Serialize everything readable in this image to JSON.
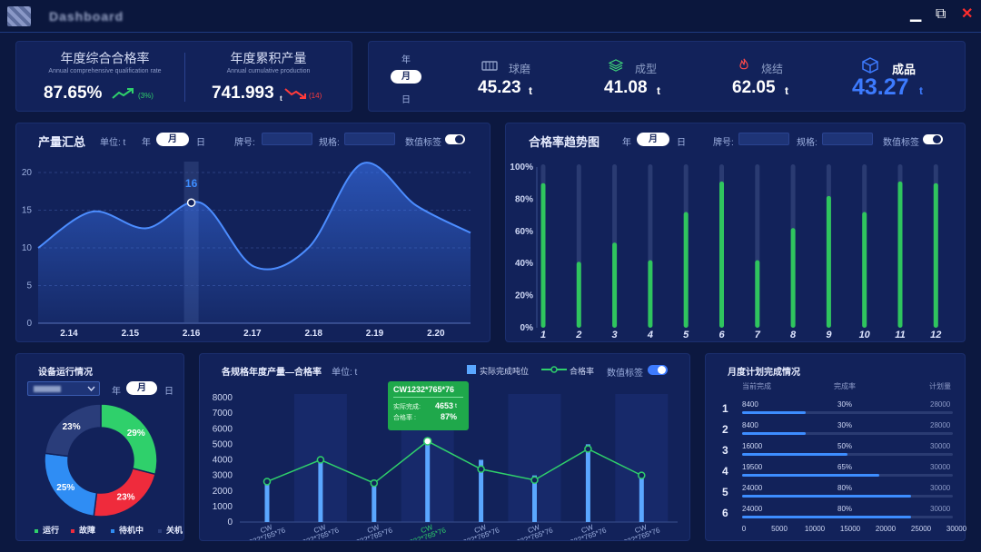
{
  "window": {
    "title": "Dashboard",
    "minimize": "▁",
    "restore": "⧉",
    "close": "✕"
  },
  "kpi_left": [
    {
      "title": "年度综合合格率",
      "subtitle": "Annual comprehensive qualification rate",
      "value": "87.65%",
      "trend": "up",
      "trend_text": "(3%)",
      "trend_color": "#2fd06b"
    },
    {
      "title": "年度累积产量",
      "subtitle": "Annual cumulative production",
      "value": "741.993",
      "unit": "t",
      "trend": "down",
      "trend_text": "(14)",
      "trend_color": "#ff3b3b"
    }
  ],
  "period_selector": {
    "options": [
      "年",
      "月",
      "日"
    ],
    "selected": "月"
  },
  "products": [
    {
      "name": "球磨",
      "value": "45.23",
      "unit": "t",
      "icon": "ball-mill-icon",
      "color": "#8fa0c8"
    },
    {
      "name": "成型",
      "value": "41.08",
      "unit": "t",
      "icon": "layers-icon",
      "color": "#3ed47a"
    },
    {
      "name": "烧结",
      "value": "62.05",
      "unit": "t",
      "icon": "flame-icon",
      "color": "#ff4a4a"
    },
    {
      "name": "成品",
      "value": "43.27",
      "unit": "t",
      "icon": "cube-icon",
      "color": "#3d7bff",
      "highlight": true
    }
  ],
  "production": {
    "title": "产量汇总",
    "unit_label": "单位: t",
    "periods": [
      "年",
      "月",
      "日"
    ],
    "selected": "月",
    "brand_label": "牌号:",
    "spec_label": "规格:",
    "toggle_label": "数值标签",
    "chart_data": {
      "type": "area",
      "x": [
        "2.14",
        "2.15",
        "2.16",
        "2.17",
        "2.18",
        "2.19",
        "2.20"
      ],
      "values": [
        10,
        14.8,
        12.6,
        16,
        7.5,
        10,
        21.2,
        15.6,
        12
      ],
      "highlight": {
        "x": "2.16",
        "value": 16,
        "label": "16"
      },
      "yticks": [
        0,
        5,
        10,
        15,
        20
      ],
      "ylim": [
        0,
        20
      ]
    }
  },
  "passrate": {
    "title": "合格率趋势图",
    "periods": [
      "年",
      "月",
      "日"
    ],
    "selected": "月",
    "brand_label": "牌号:",
    "spec_label": "规格:",
    "toggle_label": "数值标签",
    "chart_data": {
      "type": "bar",
      "categories": [
        "1",
        "2",
        "3",
        "4",
        "5",
        "6",
        "7",
        "8",
        "9",
        "10",
        "11",
        "12"
      ],
      "values": [
        90,
        41,
        53,
        42,
        72,
        91,
        42,
        62,
        82,
        72,
        91,
        90
      ],
      "yticks": [
        "0%",
        "20%",
        "40%",
        "60%",
        "80%",
        "100%"
      ],
      "ylim": [
        0,
        100
      ]
    }
  },
  "equipment": {
    "title": "设备运行情况",
    "periods": [
      "年",
      "月",
      "日"
    ],
    "selected": "月",
    "chart_data": {
      "type": "pie",
      "slices": [
        {
          "name": "运行",
          "value": 29,
          "label": "29%",
          "color": "#2fd06b"
        },
        {
          "name": "故障",
          "value": 23,
          "label": "23%",
          "color": "#ef2b3c"
        },
        {
          "name": "待机中",
          "value": 25,
          "label": "25%",
          "color": "#2f8df4"
        },
        {
          "name": "关机",
          "value": 23,
          "label": "23%",
          "color": "#2a3d7a"
        }
      ]
    }
  },
  "spec_chart": {
    "title": "各规格年度产量—合格率",
    "unit_label": "单位: t",
    "legend_bar": "实际完成吨位",
    "legend_line": "合格率",
    "toggle_label": "数值标签",
    "tooltip": {
      "title": "CW1232*765*76",
      "row1_label": "实际完成:",
      "row1_value": "4653",
      "row1_unit": "t",
      "row2_label": "合格率    :",
      "row2_value": "87%"
    },
    "chart_data": {
      "type": "bar",
      "categories": [
        "CW 1232*765*76",
        "CW 1232*765*76",
        "CW 1232*765*76",
        "CW 1232*765*76",
        "CW 1232*765*76",
        "CW 1232*765*76",
        "CW 1232*765*76",
        "CW 1232*765*76"
      ],
      "bars": [
        2700,
        3800,
        2700,
        5100,
        4000,
        3000,
        5000,
        3000
      ],
      "line": [
        2600,
        4000,
        2500,
        5200,
        3400,
        2700,
        4700,
        3000
      ],
      "yticks": [
        0,
        1000,
        2000,
        3000,
        4000,
        5000,
        6000,
        7000,
        8000
      ],
      "ylim": [
        0,
        8000
      ],
      "highlight_index": 3
    }
  },
  "monthly": {
    "title": "月度计划完成情况",
    "col1": "当前完成",
    "col2": "完成率",
    "col3": "计划量",
    "rows": [
      {
        "rank": "1",
        "current": "8400",
        "rate": "30%",
        "plan": "28000",
        "pct": 30
      },
      {
        "rank": "2",
        "current": "8400",
        "rate": "30%",
        "plan": "28000",
        "pct": 30
      },
      {
        "rank": "3",
        "current": "16000",
        "rate": "50%",
        "plan": "30000",
        "pct": 50
      },
      {
        "rank": "4",
        "current": "19500",
        "rate": "65%",
        "plan": "30000",
        "pct": 65
      },
      {
        "rank": "5",
        "current": "24000",
        "rate": "80%",
        "plan": "30000",
        "pct": 80
      },
      {
        "rank": "6",
        "current": "24000",
        "rate": "80%",
        "plan": "30000",
        "pct": 80
      }
    ],
    "xticks": [
      "0",
      "5000",
      "10000",
      "15000",
      "20000",
      "25000",
      "30000"
    ]
  }
}
